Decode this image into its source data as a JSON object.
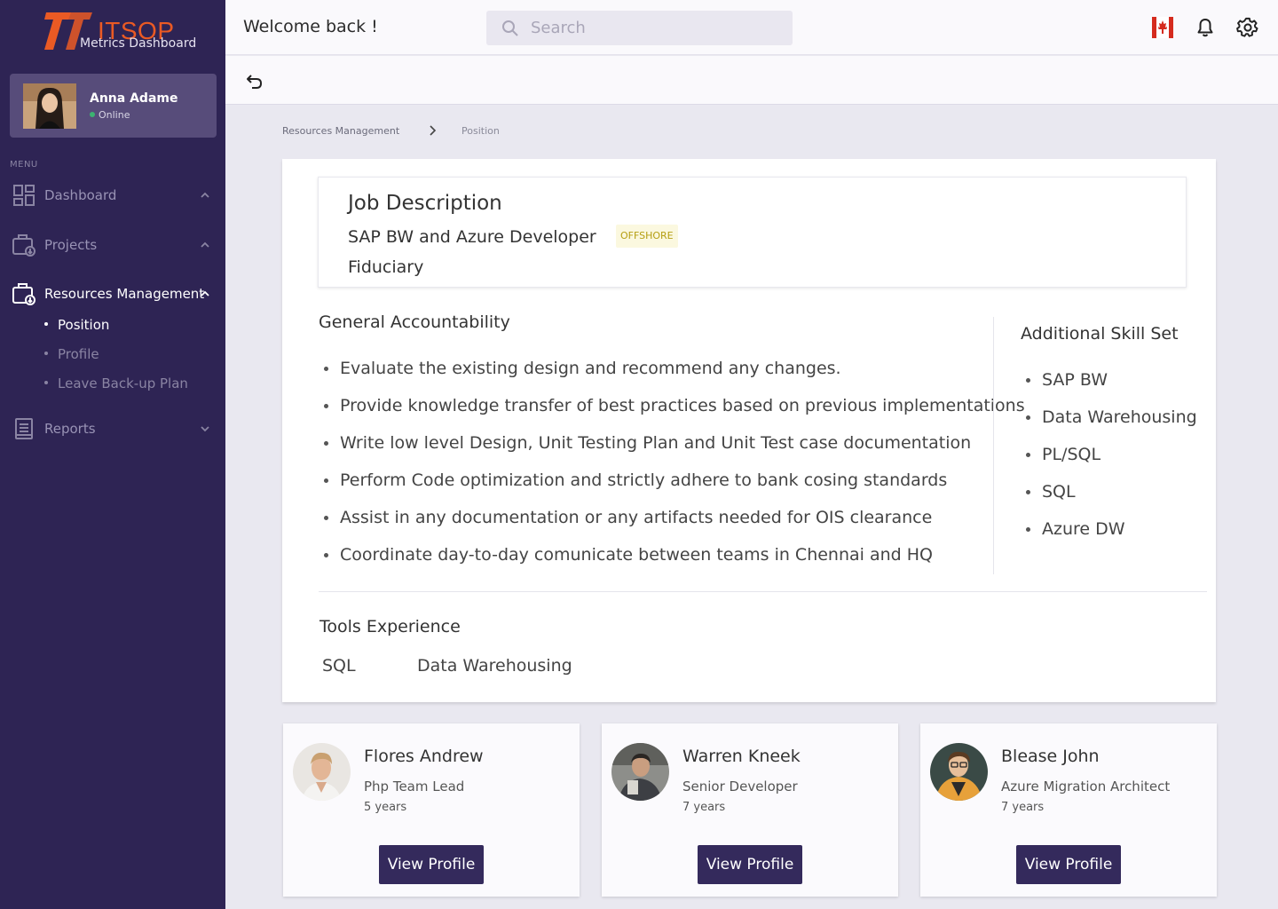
{
  "brand": {
    "title": "ITSOP",
    "subtitle": "Metrics Dashboard",
    "accent": "#ea5a24",
    "sidebar_bg": "#2e2454"
  },
  "user": {
    "name": "Anna Adame",
    "status": "Online"
  },
  "menu": {
    "label": "MENU",
    "items": [
      {
        "label": "Dashboard",
        "icon": "dashboard-icon"
      },
      {
        "label": "Projects",
        "icon": "projects-icon"
      },
      {
        "label": "Resources Management",
        "icon": "resources-icon",
        "active": true,
        "sub": [
          {
            "label": "Position",
            "active": true
          },
          {
            "label": "Profile"
          },
          {
            "label": "Leave Back-up Plan"
          }
        ]
      },
      {
        "label": "Reports",
        "icon": "reports-icon"
      }
    ]
  },
  "header": {
    "welcome": "Welcome back !",
    "search_placeholder": "Search"
  },
  "breadcrumb": {
    "parent": "Resources Management",
    "current": "Position"
  },
  "job": {
    "heading": "Job Description",
    "role": "SAP BW and Azure Developer",
    "badge": "OFFSHORE",
    "company": "Fiduciary"
  },
  "accountability": {
    "heading": "General Accountability",
    "items": [
      "Evaluate the existing design and recommend any changes.",
      "Provide knowledge transfer of best practices based on previous implementations",
      "Write low level Design, Unit Testing Plan and Unit Test case documentation",
      "Perform Code optimization and strictly adhere to bank cosing standards",
      "Assist in any documentation or any artifacts needed for OIS clearance",
      "Coordinate day-to-day comunicate between teams in Chennai and HQ"
    ]
  },
  "skills": {
    "heading": "Additional Skill Set",
    "items": [
      "SAP BW",
      "Data Warehousing",
      "PL/SQL",
      "SQL",
      "Azure DW"
    ]
  },
  "tools": {
    "heading": "Tools Experience",
    "items": [
      "SQL",
      "Data Warehousing"
    ]
  },
  "profiles": [
    {
      "name": "Flores Andrew",
      "role": "Php Team Lead",
      "experience": "5 years",
      "button": "View Profile"
    },
    {
      "name": "Warren Kneek",
      "role": "Senior Developer",
      "experience": "7 years",
      "button": "View Profile"
    },
    {
      "name": "Blease John",
      "role": "Azure Migration Architect",
      "experience": "7 years",
      "button": "View Profile"
    }
  ]
}
